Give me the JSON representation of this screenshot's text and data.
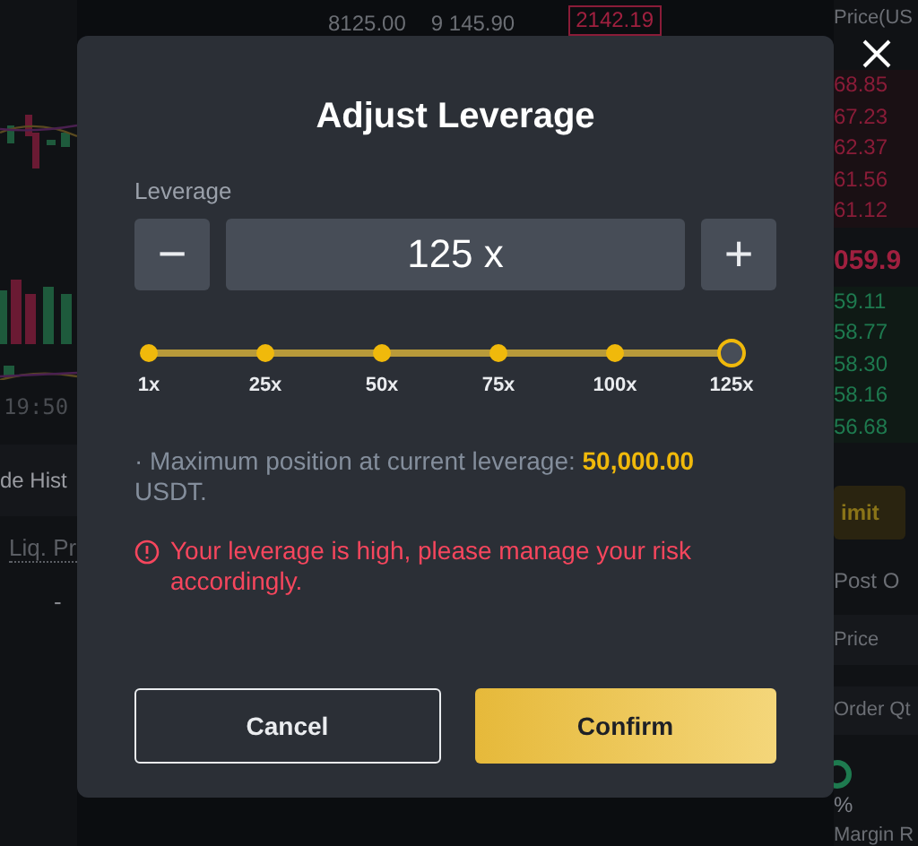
{
  "background": {
    "ticker": [
      "8125.00",
      "9 145.90"
    ],
    "last_price_tag": "2142.19",
    "chart_time": "19:50",
    "history_tab": "de Hist",
    "column_header": "Liq. Pr",
    "cell": "-",
    "order_book": {
      "header": "Price(US",
      "asks": [
        "68.85",
        "67.23",
        "62.37",
        "61.56",
        "61.12"
      ],
      "mid_price": "059.9",
      "bids": [
        "59.11",
        "58.77",
        "58.30",
        "58.16",
        "56.68"
      ]
    },
    "order_type_button": "imit",
    "post_only": "Post O",
    "price_field": {
      "placeholder": "Price"
    },
    "qty_field": {
      "placeholder": "Order Qt"
    },
    "percent": "%",
    "margin_label": "Margin R"
  },
  "dialog": {
    "title": "Adjust Leverage",
    "leverage_label": "Leverage",
    "minus": "−",
    "value": "125 x",
    "plus": "+",
    "slider": {
      "level": 1,
      "marks": [
        {
          "label": "1x"
        },
        {
          "label": "25x"
        },
        {
          "label": "50x"
        },
        {
          "label": "75x"
        },
        {
          "label": "100x"
        },
        {
          "label": "125x"
        }
      ]
    },
    "info": "· Maximum position at current leverage: **50,000.00** USDT.",
    "warning": "Your leverage is high, please manage your risk accordingly.",
    "buttons": [
      {
        "label": "Cancel",
        "kind": "secondary"
      },
      {
        "label": "Confirm",
        "kind": "primary"
      }
    ]
  }
}
